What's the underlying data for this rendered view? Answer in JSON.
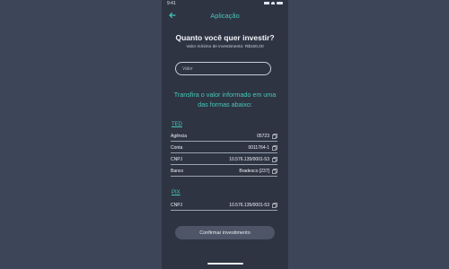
{
  "status": {
    "time": "9:41"
  },
  "header": {
    "title": "Aplicação"
  },
  "question": "Quanto você quer investir?",
  "min_value": "Valor mínimo de investimento: R$100,00",
  "valor_input": {
    "placeholder": "Valor",
    "value": ""
  },
  "transfer_text": "Transfira o valor informado em uma das formas abaixo:",
  "ted": {
    "title": "TED",
    "rows": [
      {
        "label": "Agência",
        "value": "05723"
      },
      {
        "label": "Conta",
        "value": "0011764-1"
      },
      {
        "label": "CNPJ",
        "value": "10.576.135/0001-53"
      },
      {
        "label": "Banco",
        "value": "Bradesco [237]"
      }
    ]
  },
  "pix": {
    "title": "PIX",
    "rows": [
      {
        "label": "CNPJ",
        "value": "10.576.135/0001-53"
      }
    ]
  },
  "confirm_label": "Confirmar investimento",
  "colors": {
    "accent": "#47c7b9",
    "background": "#2e3442",
    "outer": "#3d4658"
  }
}
